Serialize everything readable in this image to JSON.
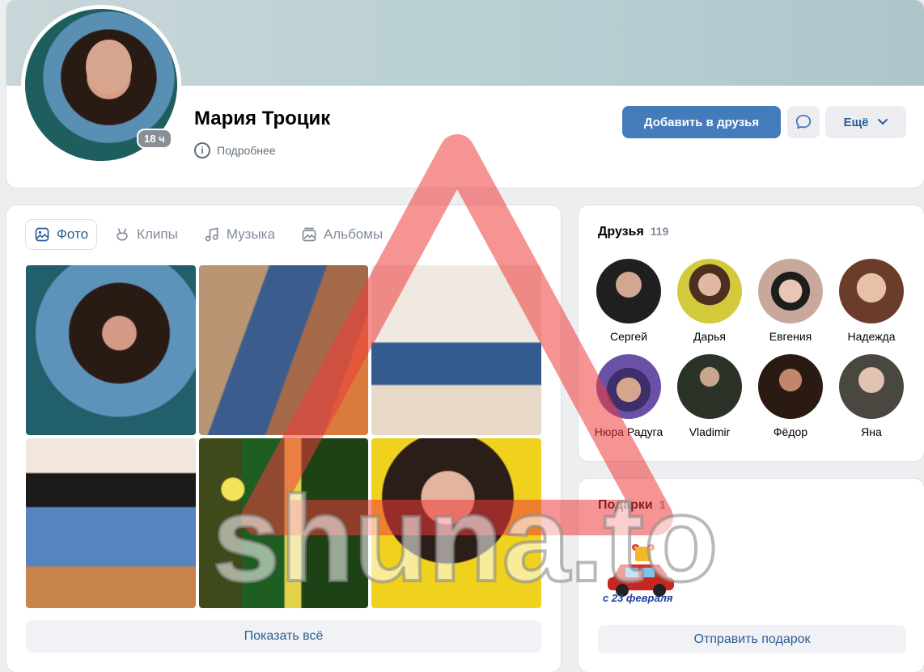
{
  "profile": {
    "name": "Мария Троцик",
    "last_seen_badge": "18 ч",
    "details_link": "Подробнее",
    "add_friend_label": "Добавить в друзья",
    "more_label": "Ещё"
  },
  "tabs": [
    {
      "label": "Фото",
      "icon": "photo-icon",
      "active": true
    },
    {
      "label": "Клипы",
      "icon": "clips-icon",
      "active": false
    },
    {
      "label": "Музыка",
      "icon": "music-icon",
      "active": false
    },
    {
      "label": "Альбомы",
      "icon": "albums-icon",
      "active": false
    }
  ],
  "photos": {
    "show_all_label": "Показать всё"
  },
  "friends": {
    "title": "Друзья",
    "count": "119",
    "items": [
      {
        "name": "Сергей"
      },
      {
        "name": "Дарья"
      },
      {
        "name": "Евгения"
      },
      {
        "name": "Надежда"
      },
      {
        "name": "Нюра Радуга"
      },
      {
        "name": "Vladimir"
      },
      {
        "name": "Фёдор"
      },
      {
        "name": "Яна"
      }
    ]
  },
  "gifts": {
    "title": "Подарки",
    "count": "1",
    "gift_caption": "с 23 февраля",
    "send_label": "Отправить подарок"
  },
  "watermark": {
    "text": "shuna.to"
  },
  "colors": {
    "accent": "#447bba",
    "link": "#2c5e94",
    "watermark_red": "#ee3b3b"
  }
}
